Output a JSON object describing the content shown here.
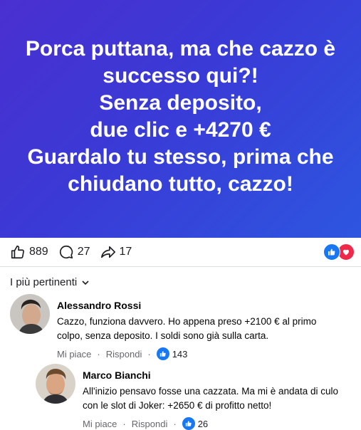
{
  "banner": {
    "lines": [
      "Porca puttana, ma che cazzo è",
      "successo qui?!",
      "Senza deposito,",
      "due clic e +4270 €",
      "Guardalo tu stesso, prima che",
      "chiudano tutto, cazzo!"
    ],
    "gradient_colors": [
      "#4a2fd0",
      "#2d56e0"
    ]
  },
  "stats": {
    "likes": "889",
    "comments": "27",
    "shares": "17",
    "reactions": [
      "like-icon",
      "love-icon"
    ]
  },
  "sort": {
    "label": "I più pertinenti"
  },
  "comments": [
    {
      "name": "Alessandro Rossi",
      "text": "Cazzo, funziona davvero. Ho appena preso +2100 € al primo colpo, senza deposito. I soldi sono già sulla carta.",
      "like_label": "Mi piace",
      "reply_label": "Rispondi",
      "like_count": "143"
    },
    {
      "name": "Marco Bianchi",
      "text": "All'inizio pensavo fosse una cazzata. Ma mi è andata di culo con le slot di Joker: +2650 € di profitto netto!",
      "like_label": "Mi piace",
      "reply_label": "Rispondi",
      "like_count": "26"
    }
  ],
  "colors": {
    "accent": "#1877f2",
    "love": "#f02849",
    "secondary_text": "#65676b"
  }
}
